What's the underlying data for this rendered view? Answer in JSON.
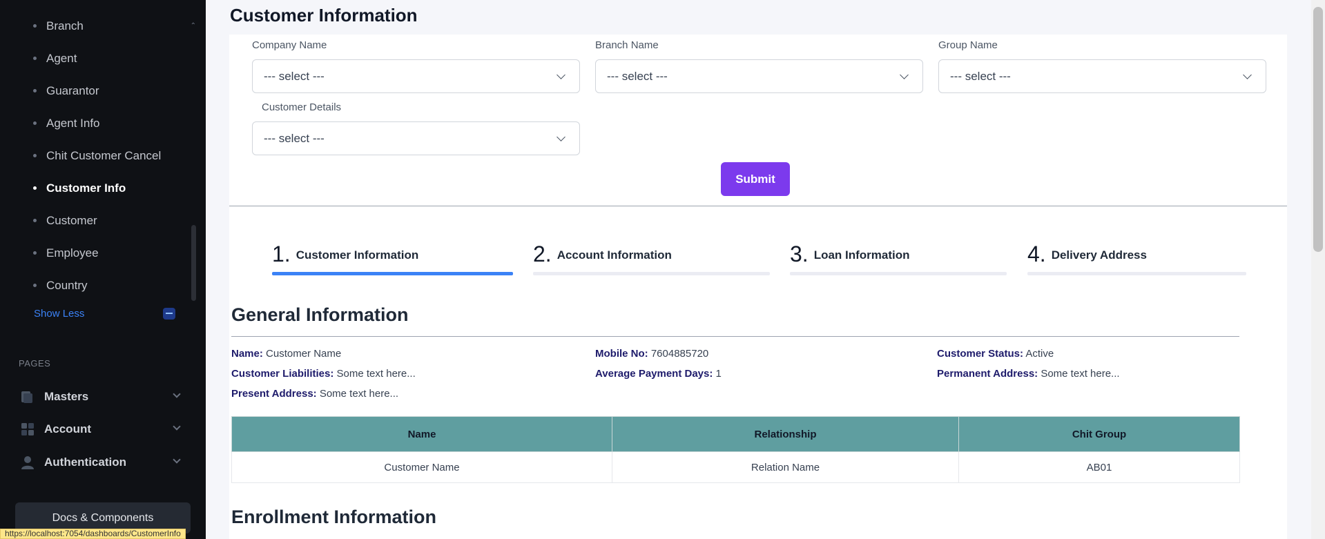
{
  "sidebar": {
    "items": [
      {
        "label": "Branch",
        "active": false
      },
      {
        "label": "Agent",
        "active": false
      },
      {
        "label": "Guarantor",
        "active": false
      },
      {
        "label": "Agent Info",
        "active": false
      },
      {
        "label": "Chit Customer Cancel",
        "active": false
      },
      {
        "label": "Customer Info",
        "active": true
      },
      {
        "label": "Customer",
        "active": false
      },
      {
        "label": "Employee",
        "active": false
      },
      {
        "label": "Country",
        "active": false
      }
    ],
    "show_less": "Show Less",
    "section_pages": "PAGES",
    "groups": [
      {
        "label": "Masters",
        "icon": "masters-icon"
      },
      {
        "label": "Account",
        "icon": "account-icon"
      },
      {
        "label": "Authentication",
        "icon": "user-icon"
      }
    ],
    "docs_button": "Docs & Components"
  },
  "status_url": "https://localhost:7054/dashboards/CustomerInfo",
  "main": {
    "page_title": "Customer Information",
    "form": {
      "company": {
        "label": "Company Name",
        "value": "--- select ---"
      },
      "branch": {
        "label": "Branch Name",
        "value": "--- select ---"
      },
      "group": {
        "label": "Group Name",
        "value": "--- select ---"
      },
      "customer": {
        "label": "Customer Details",
        "value": "--- select ---"
      },
      "submit_label": "Submit"
    },
    "steps": [
      {
        "num": "1.",
        "label": "Customer Information",
        "active": true
      },
      {
        "num": "2.",
        "label": "Account Information",
        "active": false
      },
      {
        "num": "3.",
        "label": "Loan Information",
        "active": false
      },
      {
        "num": "4.",
        "label": "Delivery Address",
        "active": false
      }
    ],
    "general": {
      "title": "General Information",
      "fields": {
        "name": {
          "label": "Name:",
          "value": "Customer Name"
        },
        "mobile": {
          "label": "Mobile No:",
          "value": "7604885720"
        },
        "status": {
          "label": "Customer Status:",
          "value": "Active"
        },
        "liabilities": {
          "label": "Customer Liabilities:",
          "value": "Some text here..."
        },
        "avg_days": {
          "label": "Average Payment Days:",
          "value": "1"
        },
        "permanent": {
          "label": "Permanent Address:",
          "value": "Some text here..."
        },
        "present": {
          "label": "Present Address:",
          "value": "Some text here..."
        }
      }
    },
    "table": {
      "headers": [
        "Name",
        "Relationship",
        "Chit Group"
      ],
      "rows": [
        [
          "Customer Name",
          "Relation Name",
          "AB01"
        ]
      ]
    },
    "enrollment_title": "Enrollment Information"
  },
  "colors": {
    "sidebar_bg": "#0f1115",
    "accent_purple": "#7c3aed",
    "active_step": "#3b82f6",
    "table_header": "#5f9ea0"
  }
}
